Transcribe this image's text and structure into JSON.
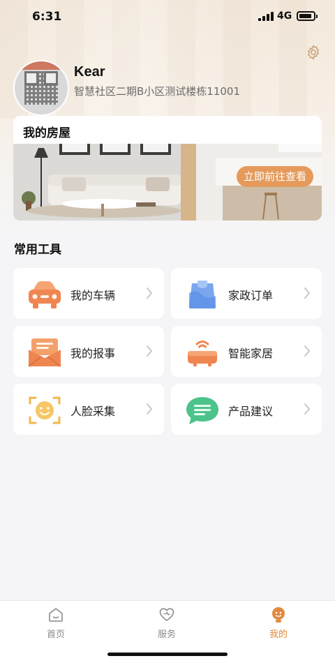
{
  "status_bar": {
    "time": "6:31",
    "network": "4G",
    "battery_level": 0.9
  },
  "profile": {
    "name": "Kear",
    "address": "智慧社区二期B小区测试楼栋11001"
  },
  "my_house": {
    "title": "我的房屋",
    "cta_label": "立即前往查看"
  },
  "tools": {
    "title": "常用工具",
    "items": [
      {
        "label": "我的车辆",
        "icon": "car-icon"
      },
      {
        "label": "家政订单",
        "icon": "clipboard-icon"
      },
      {
        "label": "我的报事",
        "icon": "mail-icon"
      },
      {
        "label": "智能家居",
        "icon": "smart-home-icon"
      },
      {
        "label": "人脸采集",
        "icon": "face-scan-icon"
      },
      {
        "label": "产品建议",
        "icon": "chat-bubble-icon"
      }
    ]
  },
  "bottom_nav": {
    "items": [
      {
        "label": "首页",
        "icon": "home-icon",
        "active": false
      },
      {
        "label": "服务",
        "icon": "heart-icon",
        "active": false
      },
      {
        "label": "我的",
        "icon": "profile-icon",
        "active": true
      }
    ]
  },
  "colors": {
    "accent": "#e08a3c",
    "cta_background": "#e59a5c",
    "page_background": "#f5f5f7",
    "card_background": "#ffffff"
  }
}
